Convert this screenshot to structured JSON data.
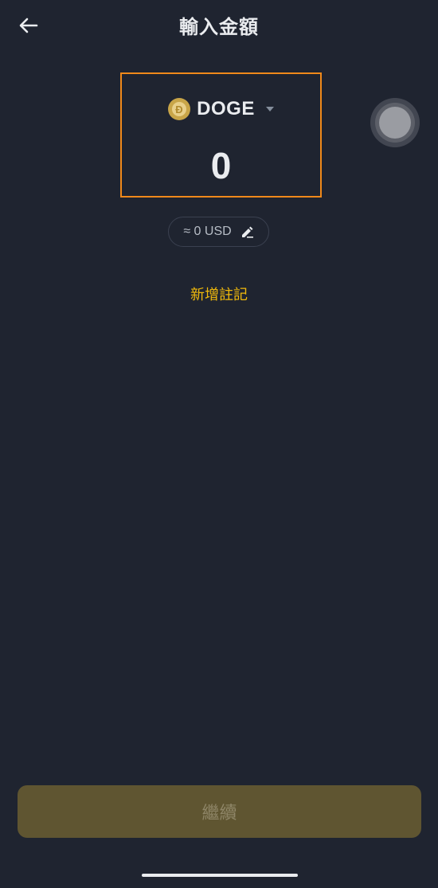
{
  "header": {
    "title": "輸入金額",
    "back_icon": "arrow-left-icon"
  },
  "amount": {
    "coin_symbol": "DOGE",
    "coin_icon": "doge-coin-icon",
    "value": "0",
    "highlight_color": "#f0891a"
  },
  "conversion": {
    "text": "≈ 0 USD",
    "edit_icon": "pencil-edit-icon"
  },
  "note": {
    "label": "新增註記",
    "color": "#f0b90b"
  },
  "footer": {
    "continue_label": "繼續",
    "button_color": "#5f5531"
  },
  "theme": {
    "background": "#1f2430",
    "text": "#eaecef"
  }
}
